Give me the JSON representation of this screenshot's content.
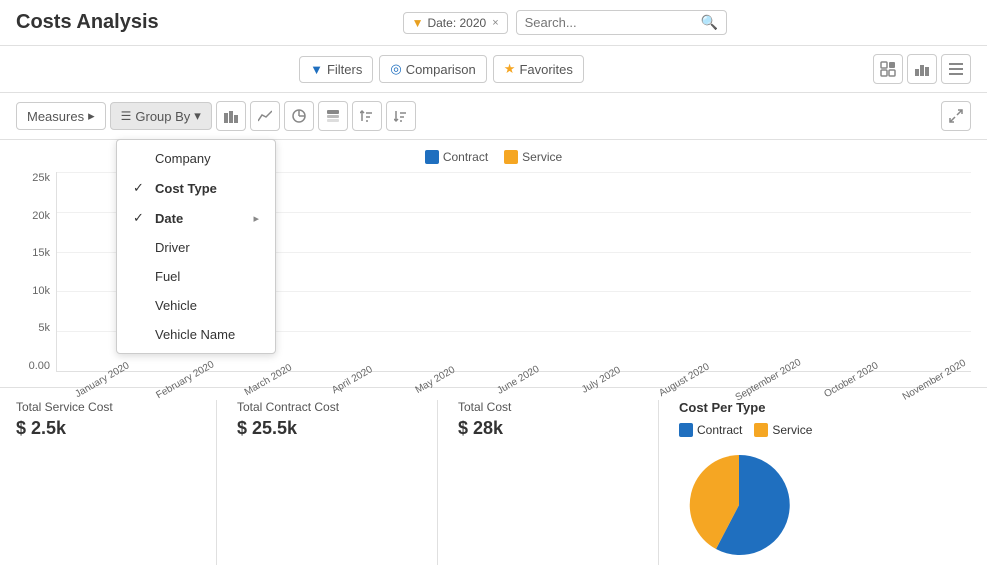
{
  "header": {
    "title": "Costs Analysis",
    "filter": {
      "label": "Date: 2020",
      "funnel": "▼",
      "close": "×"
    },
    "search_placeholder": "Search...",
    "toolbar": {
      "filters_label": "Filters",
      "comparison_label": "Comparison",
      "favorites_label": "Favorites"
    }
  },
  "sub_toolbar": {
    "measures_label": "Measures",
    "group_by_label": "Group By"
  },
  "dropdown": {
    "items": [
      {
        "id": "company",
        "label": "Company",
        "checked": false,
        "has_arrow": false
      },
      {
        "id": "cost_type",
        "label": "Cost Type",
        "checked": true,
        "has_arrow": false
      },
      {
        "id": "date",
        "label": "Date",
        "checked": true,
        "has_arrow": true
      },
      {
        "id": "driver",
        "label": "Driver",
        "checked": false,
        "has_arrow": false
      },
      {
        "id": "fuel",
        "label": "Fuel",
        "checked": false,
        "has_arrow": false
      },
      {
        "id": "vehicle",
        "label": "Vehicle",
        "checked": false,
        "has_arrow": false
      },
      {
        "id": "vehicle_name",
        "label": "Vehicle Name",
        "checked": false,
        "has_arrow": false
      }
    ]
  },
  "chart": {
    "legend": [
      {
        "id": "contract",
        "label": "Contract",
        "color": "#1f6fbf"
      },
      {
        "id": "service",
        "label": "Service",
        "color": "#f5a623"
      }
    ],
    "y_labels": [
      "25k",
      "20k",
      "15k",
      "10k",
      "5k",
      "0.00"
    ],
    "months": [
      "January 2020",
      "February 2020",
      "March 2020",
      "April 2020",
      "May 2020",
      "June 2020",
      "July 2020",
      "August 2020",
      "September 2020",
      "October 2020",
      "November 2020"
    ],
    "contract_data": [
      100,
      10,
      2,
      2,
      1,
      1,
      1,
      2,
      1,
      5,
      2
    ],
    "service_data": [
      0,
      0,
      0,
      0,
      0,
      1,
      1,
      1,
      1,
      3,
      1
    ]
  },
  "summary": {
    "total_service_cost_label": "Total Service Cost",
    "total_service_cost_value": "$ 2.5k",
    "total_contract_cost_label": "Total Contract Cost",
    "total_contract_cost_value": "$ 25.5k",
    "total_cost_label": "Total Cost",
    "total_cost_value": "$ 28k",
    "pie_title": "Cost Per Type",
    "pie_legend": [
      {
        "label": "Contract",
        "color": "#1f6fbf"
      },
      {
        "label": "Service",
        "color": "#f5a623"
      }
    ]
  },
  "icons": {
    "filter_funnel": "▼",
    "search": "🔍",
    "comparison": "◎",
    "star": "★",
    "grid": "⊞",
    "bar_chart": "▦",
    "list": "≡",
    "stack": "⊟",
    "sort_asc": "↑",
    "sort_desc": "↓",
    "expand": "⤢",
    "down_arrow": "▾"
  }
}
